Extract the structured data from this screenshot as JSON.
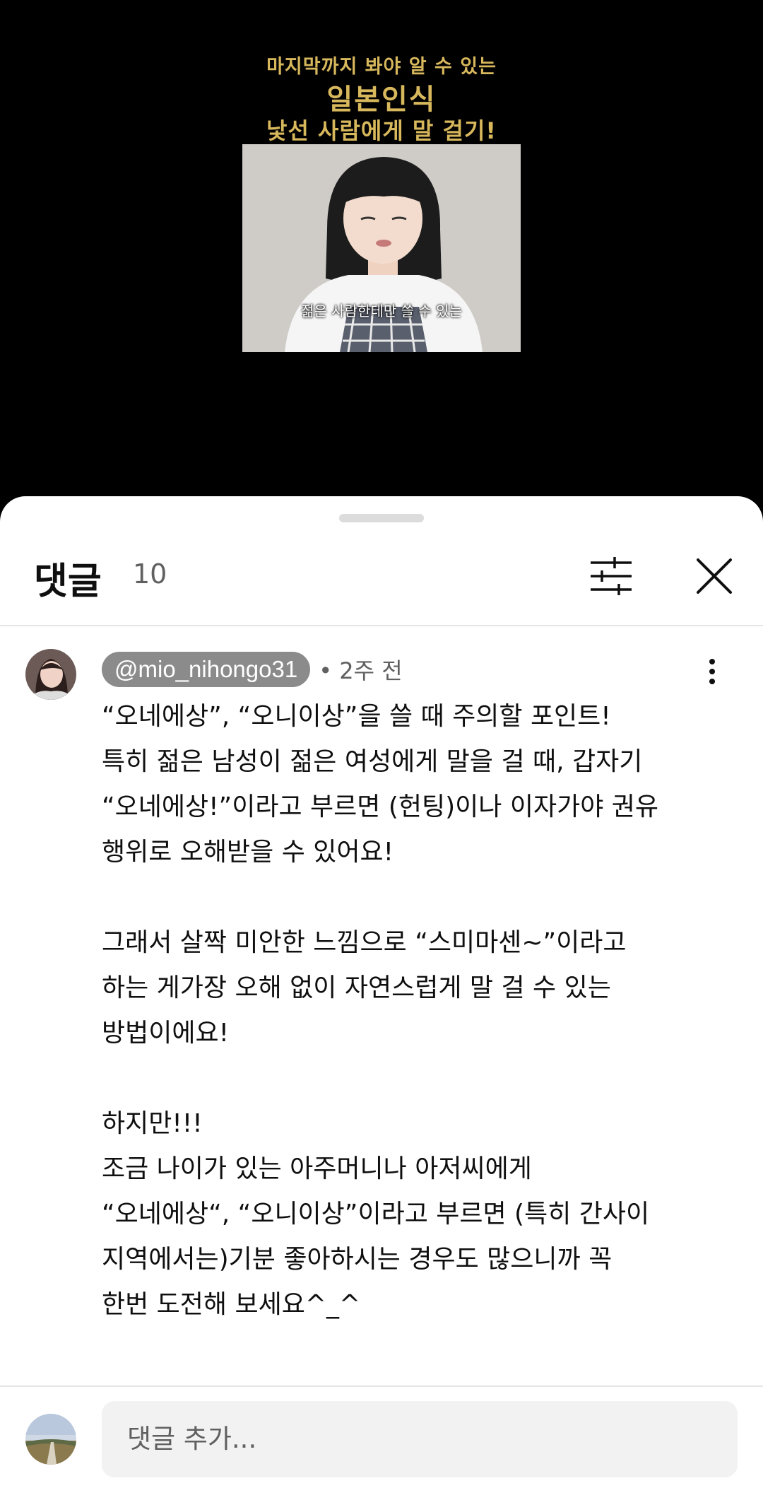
{
  "video": {
    "title_line1": "마지막까지 봐야 알 수 있는",
    "title_line2": "일본인식",
    "title_line3": "낯선 사람에게 말 걸기!",
    "subtitle": "젊은 사람한테만 쓸 수 있는"
  },
  "sheet": {
    "title": "댓글",
    "count": "10",
    "filter_icon": "filter-sliders-icon",
    "close_icon": "close-icon"
  },
  "comment": {
    "author": "@mio_nihongo31",
    "time": "• 2주 전",
    "body": {
      "p1": [
        "“오네에상”, “오니이상”을 쓸 때 주의할 포인트!",
        "특히 젊은 남성이 젊은 여성에게 말을 걸 때, 갑자기",
        "“오네에상!”이라고 부르면 (헌팅)이나 이자가야 권유",
        "행위로 오해받을 수 있어요!"
      ],
      "p2": [
        "그래서 살짝 미안한 느낌으로 “스미마센~”이라고",
        "하는 게가장 오해 없이 자연스럽게 말 걸 수 있는",
        "방법이에요!"
      ],
      "p3": [
        "하지만!!!",
        "조금 나이가 있는 아주머니나 아저씨에게",
        "“오네에상“, “오니이상”이라고 부르면 (특히 간사이",
        "지역에서는)기분 좋아하시는 경우도 많으니까 꼭",
        "한번 도전해 보세요^_^"
      ]
    }
  },
  "add_comment": {
    "placeholder": "댓글 추가..."
  }
}
